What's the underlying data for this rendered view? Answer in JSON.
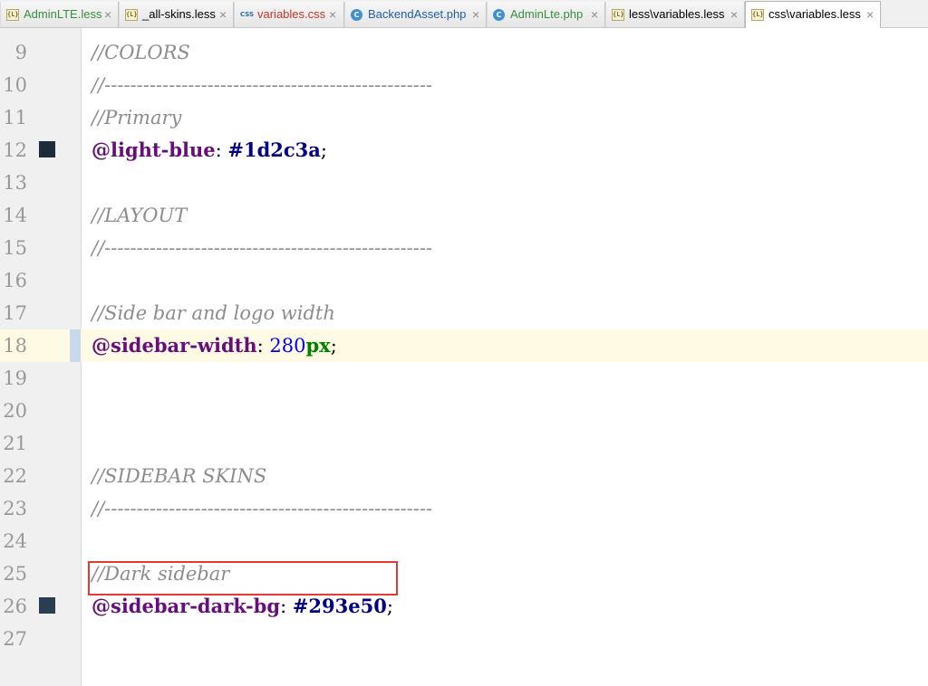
{
  "tabs": [
    {
      "name": "AdminLTE.less",
      "icon": "less-file-icon",
      "color": "#388e3c",
      "active": false
    },
    {
      "name": "_all-skins.less",
      "icon": "less-file-icon",
      "color": "#000000",
      "active": false
    },
    {
      "name": "variables.css",
      "icon": "css-file-icon",
      "color": "#c0392b",
      "active": false
    },
    {
      "name": "BackendAsset.php",
      "icon": "php-class-icon",
      "color": "#1f5fa8",
      "active": false
    },
    {
      "name": "AdminLte.php",
      "icon": "php-class-icon",
      "color": "#388e3c",
      "active": false
    },
    {
      "name": "less\\variables.less",
      "icon": "less-file-icon",
      "color": "#000000",
      "active": false
    },
    {
      "name": "css\\variables.less",
      "icon": "less-file-icon",
      "color": "#000000",
      "active": true
    }
  ],
  "icon_labels": {
    "less": "{L}",
    "css": "CSS",
    "php": "C",
    "close": "×"
  },
  "lines": [
    {
      "num": "9",
      "tokens": [
        {
          "t": "//COLORS",
          "c": "comment"
        }
      ]
    },
    {
      "num": "10",
      "tokens": [
        {
          "t": "//---------------------------------------------------",
          "c": "comment"
        }
      ]
    },
    {
      "num": "11",
      "tokens": [
        {
          "t": "//Primary",
          "c": "comment"
        }
      ]
    },
    {
      "num": "12",
      "swatch": "#1d2c3a",
      "tokens": [
        {
          "t": "@light-blue",
          "c": "var"
        },
        {
          "t": ": ",
          "c": "punct"
        },
        {
          "t": "#1d2c3a",
          "c": "hex"
        },
        {
          "t": ";",
          "c": "punct"
        }
      ]
    },
    {
      "num": "13",
      "tokens": []
    },
    {
      "num": "14",
      "tokens": [
        {
          "t": "//LAYOUT",
          "c": "comment"
        }
      ]
    },
    {
      "num": "15",
      "tokens": [
        {
          "t": "//---------------------------------------------------",
          "c": "comment"
        }
      ]
    },
    {
      "num": "16",
      "tokens": []
    },
    {
      "num": "17",
      "tokens": [
        {
          "t": "//Side bar and logo width",
          "c": "comment"
        }
      ]
    },
    {
      "num": "18",
      "current": true,
      "tokens": [
        {
          "t": "@sidebar-width",
          "c": "var"
        },
        {
          "t": ": ",
          "c": "punct"
        },
        {
          "t": "280",
          "c": "num"
        },
        {
          "t": "px",
          "c": "unit"
        },
        {
          "t": ";",
          "c": "punct"
        }
      ]
    },
    {
      "num": "19",
      "tokens": []
    },
    {
      "num": "20",
      "tokens": []
    },
    {
      "num": "21",
      "tokens": []
    },
    {
      "num": "22",
      "tokens": [
        {
          "t": "//SIDEBAR SKINS",
          "c": "comment"
        }
      ]
    },
    {
      "num": "23",
      "tokens": [
        {
          "t": "//---------------------------------------------------",
          "c": "comment"
        }
      ]
    },
    {
      "num": "24",
      "tokens": []
    },
    {
      "num": "25",
      "tokens": [
        {
          "t": "//Dark sidebar",
          "c": "comment"
        }
      ]
    },
    {
      "num": "26",
      "swatch": "#293e50",
      "highlighted": true,
      "tokens": [
        {
          "t": "@sidebar-dark-bg",
          "c": "var"
        },
        {
          "t": ": ",
          "c": "punct"
        },
        {
          "t": "#293e50",
          "c": "hex"
        },
        {
          "t": ";",
          "c": "punct"
        }
      ]
    },
    {
      "num": "27",
      "tokens": []
    }
  ],
  "colors": {
    "highlight_border": "#e53935",
    "current_line": "#fffae3"
  }
}
